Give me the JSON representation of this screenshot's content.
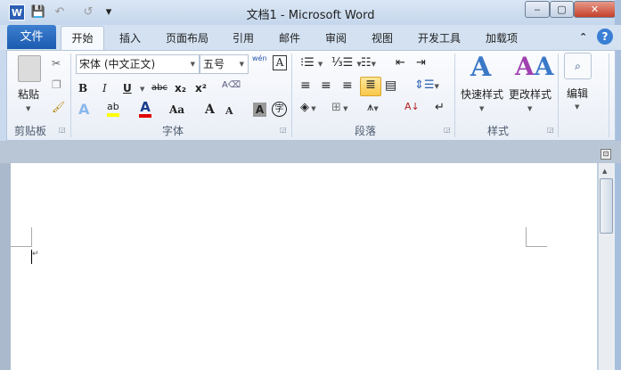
{
  "window": {
    "title": "文档1  -  Microsoft Word",
    "minimize": "‒",
    "maximize": "▢",
    "close": "✕"
  },
  "quick_access": {
    "word_logo": "W",
    "save": "💾",
    "undo": "↶",
    "redo": "↺",
    "customize": "▾"
  },
  "tabs": [
    {
      "label": "文件"
    },
    {
      "label": "开始"
    },
    {
      "label": "插入"
    },
    {
      "label": "页面布局"
    },
    {
      "label": "引用"
    },
    {
      "label": "邮件"
    },
    {
      "label": "审阅"
    },
    {
      "label": "视图"
    },
    {
      "label": "开发工具"
    },
    {
      "label": "加载项"
    }
  ],
  "ribbon_controls": {
    "collapse": "⌃",
    "help": "?"
  },
  "clipboard": {
    "label": "剪贴板",
    "paste": "粘贴"
  },
  "font": {
    "label": "字体",
    "font_name": "宋体 (中文正文)",
    "font_size": "五号",
    "phonetic": "wén",
    "bold": "B",
    "italic": "I",
    "underline": "U",
    "strike": "abc",
    "sub": "x₂",
    "sup": "x²",
    "text_effects": "A",
    "highlight": "ab",
    "font_color": "A",
    "change_case": "Aa",
    "grow": "A",
    "shrink": "A",
    "char_shading": "A",
    "enclose": "字",
    "char_border": "A",
    "highlight_color": "#ffff00",
    "font_color_value": "#e00000"
  },
  "paragraph": {
    "label": "段落"
  },
  "styles": {
    "label": "样式",
    "quick_styles": "快速样式",
    "change_styles": "更改样式"
  },
  "editing": {
    "label": "编辑"
  },
  "document": {
    "cursor_mark": "↵"
  }
}
